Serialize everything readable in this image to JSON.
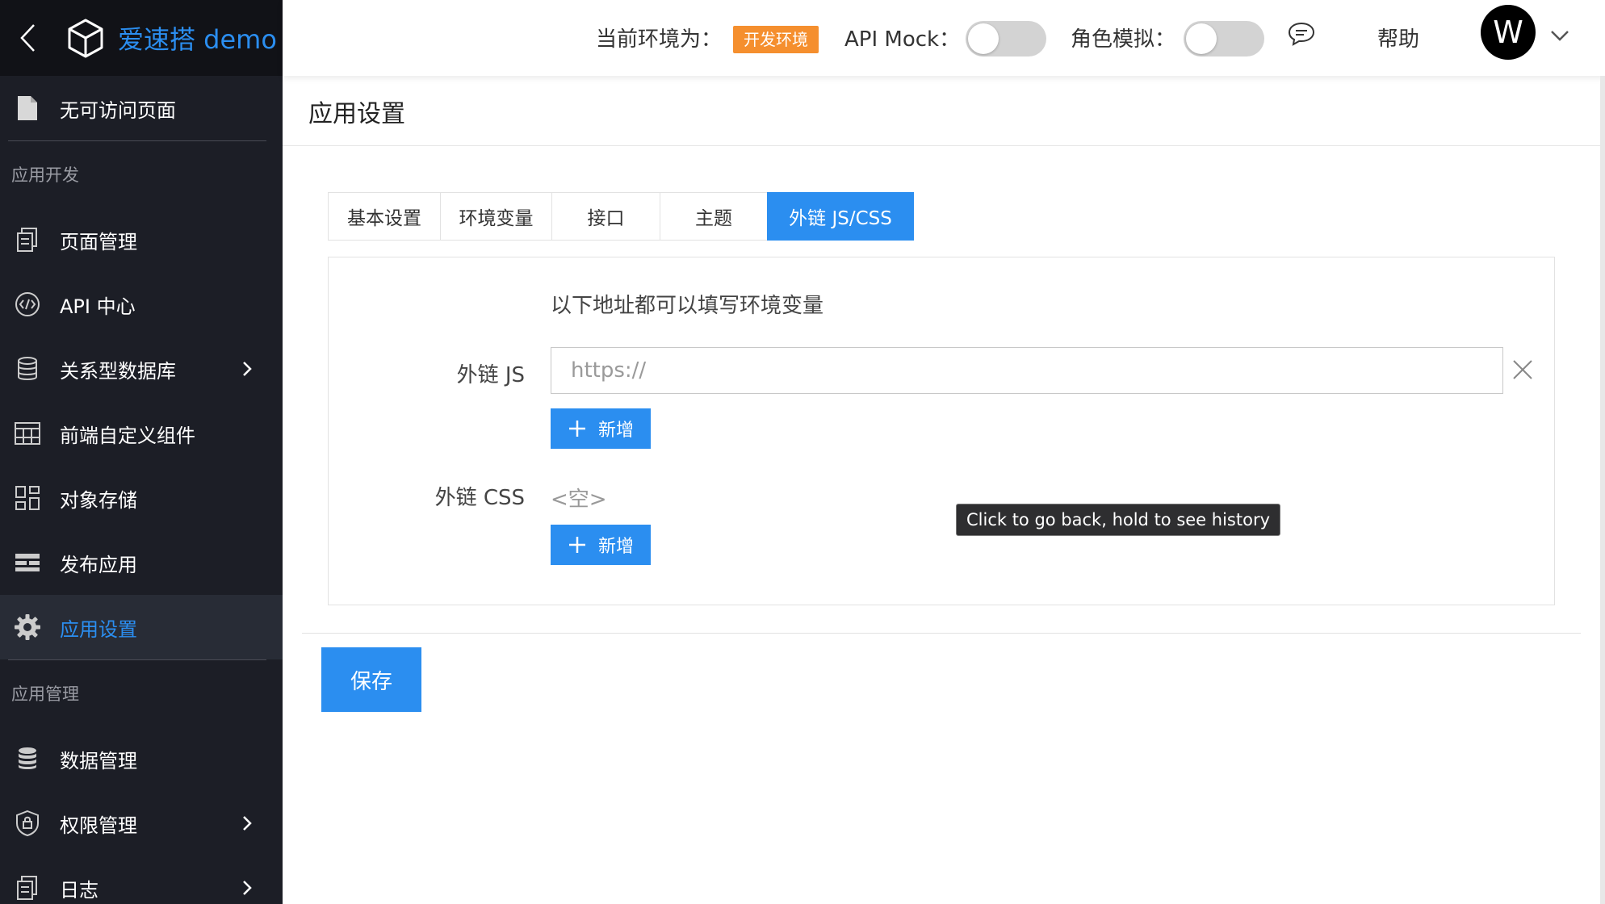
{
  "sidebar": {
    "brand": "爱速搭 demo",
    "top_item": "无可访问页面",
    "section_dev": "应用开发",
    "dev_items": [
      {
        "label": "页面管理"
      },
      {
        "label": "API 中心"
      },
      {
        "label": "关系型数据库"
      },
      {
        "label": "前端自定义组件"
      },
      {
        "label": "对象存储"
      },
      {
        "label": "发布应用"
      },
      {
        "label": "应用设置"
      }
    ],
    "section_manage": "应用管理",
    "manage_items": [
      {
        "label": "数据管理"
      },
      {
        "label": "权限管理"
      },
      {
        "label": "日志"
      }
    ],
    "accent_color": "#2b8ef0"
  },
  "header": {
    "env_label": "当前环境为：",
    "env_badge": "开发环境",
    "api_mock_label": "API Mock：",
    "role_sim_label": "角色模拟：",
    "help": "帮助",
    "avatar_letter": "W"
  },
  "page": {
    "title": "应用设置",
    "tabs": [
      {
        "label": "基本设置"
      },
      {
        "label": "环境变量"
      },
      {
        "label": "接口"
      },
      {
        "label": "主题"
      },
      {
        "label": "外链 JS/CSS"
      }
    ],
    "hint": "以下地址都可以填写环境变量",
    "js_label": "外链 JS",
    "js_placeholder": "https://",
    "add_label": "新增",
    "css_label": "外链 CSS",
    "css_empty": "<空>",
    "save": "保存"
  },
  "tooltip": "Click to go back, hold to see history"
}
